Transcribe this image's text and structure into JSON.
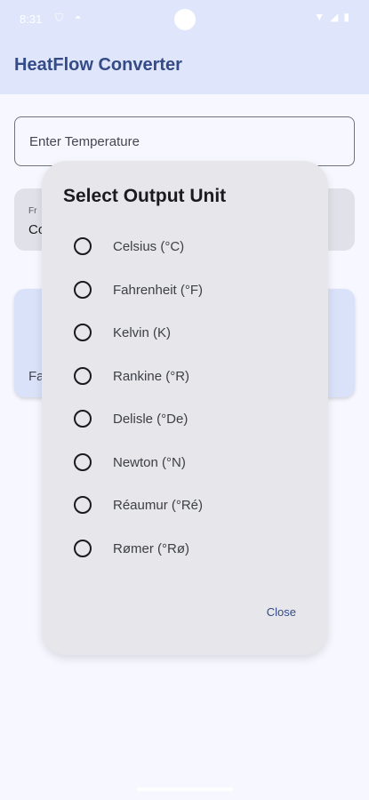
{
  "status_bar": {
    "time": "8:31",
    "icons": [
      "shield-icon",
      "android-icon",
      "wifi-icon",
      "signal-icon",
      "battery-icon"
    ]
  },
  "app_bar": {
    "title": "HeatFlow Converter"
  },
  "main": {
    "input_placeholder": "Enter Temperature",
    "from_card_label": "Fr",
    "from_card_value": "Co",
    "result_card_label": "Fa"
  },
  "dialog": {
    "title": "Select Output Unit",
    "options": [
      {
        "label": "Celsius (°C)",
        "selected": false
      },
      {
        "label": "Fahrenheit (°F)",
        "selected": false
      },
      {
        "label": "Kelvin (K)",
        "selected": false
      },
      {
        "label": "Rankine (°R)",
        "selected": false
      },
      {
        "label": "Delisle (°De)",
        "selected": false
      },
      {
        "label": "Newton (°N)",
        "selected": false
      },
      {
        "label": "Réaumur (°Ré)",
        "selected": false
      },
      {
        "label": "Rømer (°Rø)",
        "selected": false
      }
    ],
    "close_label": "Close"
  },
  "colors": {
    "app_bar_bg": "#dfe6fb",
    "title_color": "#344b87",
    "dialog_bg": "#e7e6ea"
  }
}
